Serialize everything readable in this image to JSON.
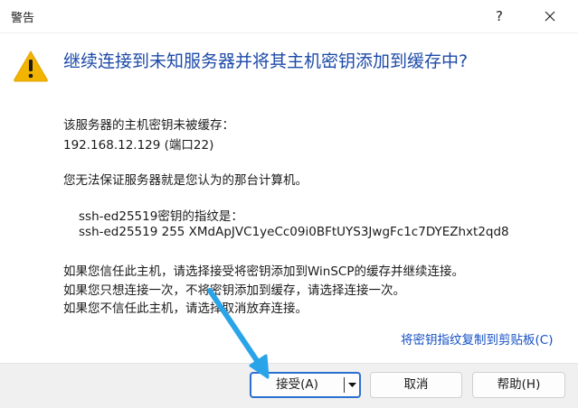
{
  "window": {
    "title": "警告",
    "help_label": "?"
  },
  "heading": "继续连接到未知服务器并将其主机密钥添加到缓存中?",
  "messages": {
    "line1": "该服务器的主机密钥未被缓存：",
    "line2": "192.168.12.129 (端口22)",
    "line3": "您无法保证服务器就是您认为的那台计算机。",
    "line4": "ssh-ed25519密钥的指纹是：",
    "line5": "ssh-ed25519 255 XMdApJVC1yeCc09i0BFtUYS3JwgFc1c7DYEZhxt2qd8",
    "line6": "如果您信任此主机，请选择接受将密钥添加到WinSCP的缓存并继续连接。",
    "line7": "如果您只想连接一次，不将密钥添加到缓存，请选择连接一次。",
    "line8": "如果您不信任此主机，请选择取消放弃连接。"
  },
  "copy_link": "将密钥指纹复制到剪贴板(C)",
  "buttons": {
    "accept": "接受(A)",
    "cancel": "取消",
    "help": "帮助(H)"
  },
  "colors": {
    "heading": "#1d4aa8",
    "link": "#1550c4",
    "accent": "#2b6fd0",
    "arrow": "#2aa4e8",
    "warning": "#f2b400"
  },
  "icons": [
    "warning-icon",
    "close-icon",
    "dropdown-arrow-icon",
    "annotation-arrow"
  ]
}
